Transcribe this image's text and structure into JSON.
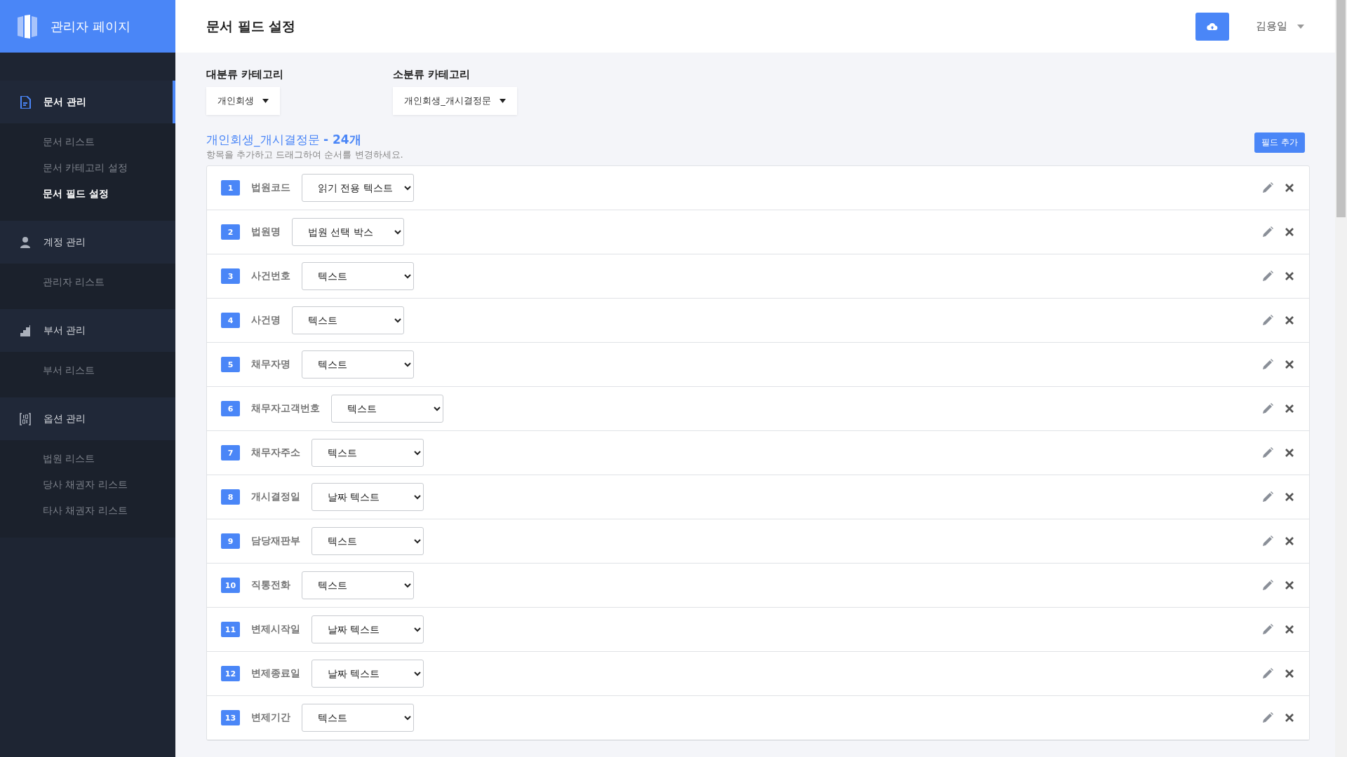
{
  "sidebar": {
    "brand": "관리자 페이지",
    "groups": [
      {
        "kind": "document",
        "title": "문서 관리",
        "selected": true,
        "items": [
          {
            "label": "문서 리스트",
            "selected": false
          },
          {
            "label": "문서 카테고리 설정",
            "selected": false
          },
          {
            "label": "문서 필드 설정",
            "selected": true
          }
        ]
      },
      {
        "kind": "person",
        "title": "계정 관리",
        "selected": false,
        "items": [
          {
            "label": "관리자 리스트",
            "selected": false
          }
        ]
      },
      {
        "kind": "chart",
        "title": "부서 관리",
        "selected": false,
        "items": [
          {
            "label": "부서 리스트",
            "selected": false
          }
        ]
      },
      {
        "kind": "binary",
        "title": "옵션 관리",
        "selected": false,
        "items": [
          {
            "label": "법원 리스트",
            "selected": false
          },
          {
            "label": "당사 채권자 리스트",
            "selected": false
          },
          {
            "label": "타사 채권자 리스트",
            "selected": false
          }
        ]
      }
    ]
  },
  "header": {
    "title": "문서 필드 설정",
    "user": "김용일"
  },
  "filters": [
    {
      "label": "대분류 카테고리",
      "value": "개인회생"
    },
    {
      "label": "소분류 카테고리",
      "value": "개인회생_개시결정문"
    }
  ],
  "section": {
    "title": "개인회생_개시결정문 **- 24개**",
    "hint": "항목을 추가하고 드래그하여 순서를 변경하세요.",
    "add_button": "필드 추가"
  },
  "fields": [
    {
      "number": "1",
      "name": "법원코드",
      "type": "읽기 전용 텍스트"
    },
    {
      "number": "2",
      "name": "법원명",
      "type": "법원 선택 박스"
    },
    {
      "number": "3",
      "name": "사건번호",
      "type": "텍스트"
    },
    {
      "number": "4",
      "name": "사건명",
      "type": "텍스트"
    },
    {
      "number": "5",
      "name": "채무자명",
      "type": "텍스트"
    },
    {
      "number": "6",
      "name": "채무자고객번호",
      "type": "텍스트"
    },
    {
      "number": "7",
      "name": "채무자주소",
      "type": "텍스트"
    },
    {
      "number": "8",
      "name": "개시결정일",
      "type": "날짜 텍스트"
    },
    {
      "number": "9",
      "name": "담당재판부",
      "type": "텍스트"
    },
    {
      "number": "10",
      "name": "직통전화",
      "type": "텍스트"
    },
    {
      "number": "11",
      "name": "변제시작일",
      "type": "날짜 텍스트"
    },
    {
      "number": "12",
      "name": "변제종료일",
      "type": "날짜 텍스트"
    },
    {
      "number": "13",
      "name": "변제기간",
      "type": "텍스트"
    }
  ]
}
